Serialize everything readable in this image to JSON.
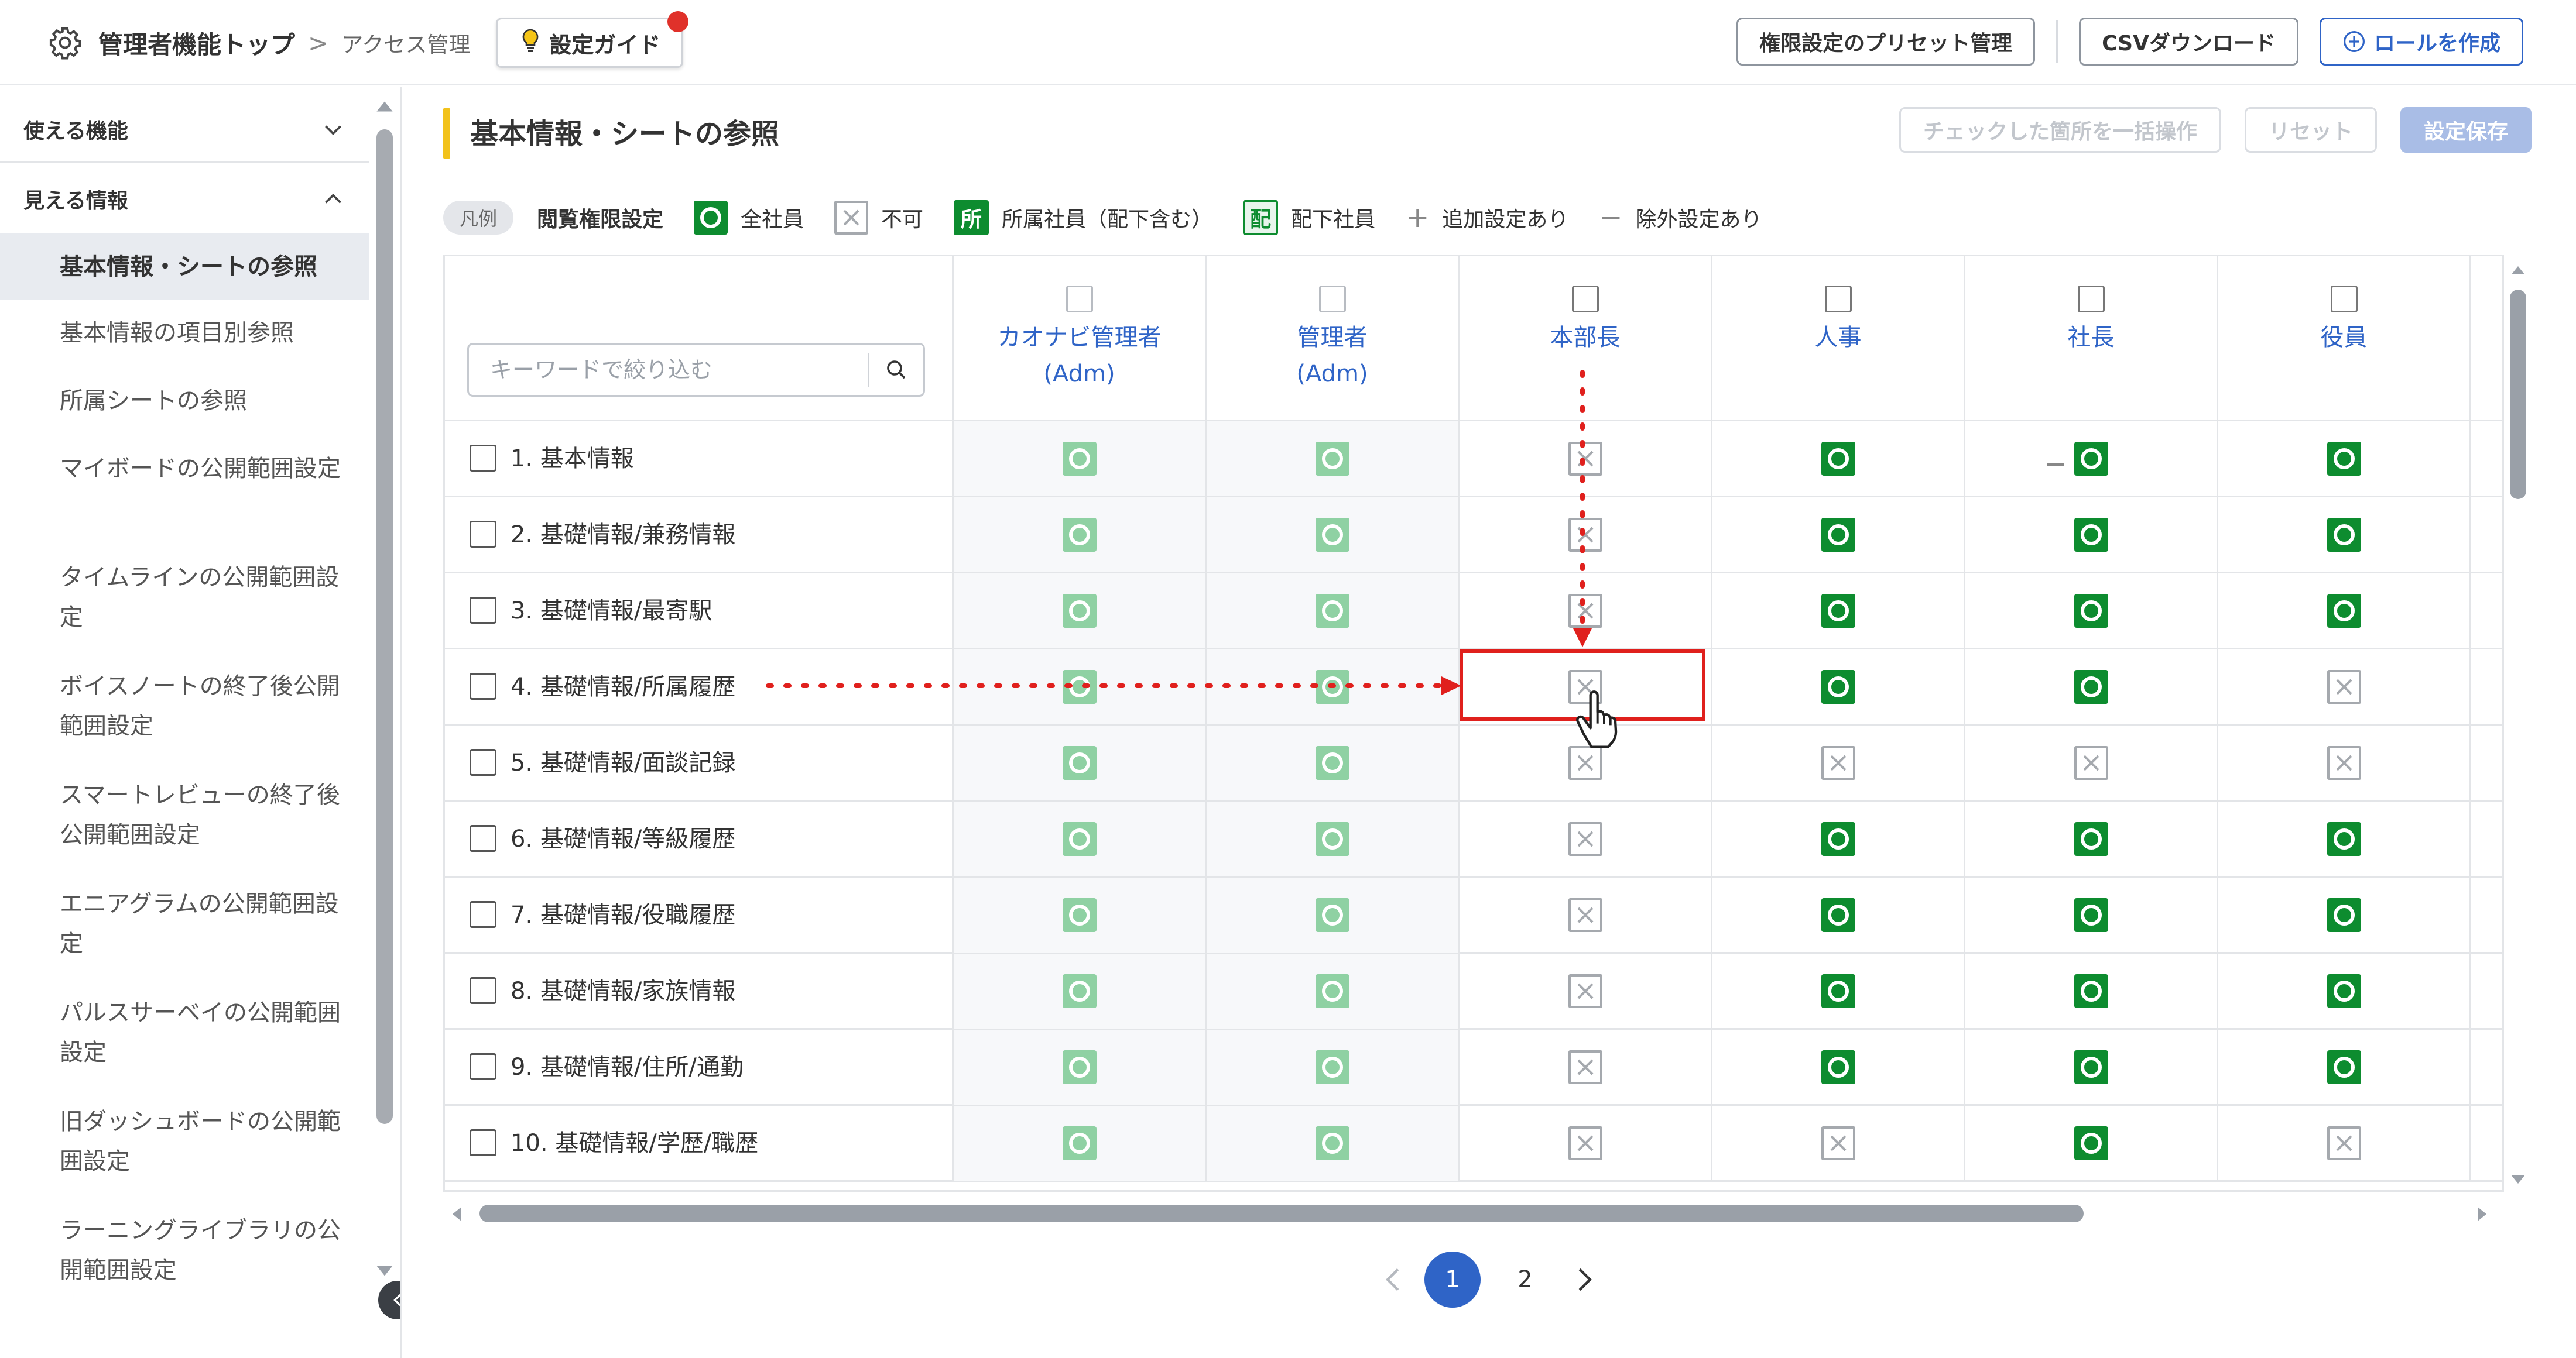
{
  "header": {
    "admin_top": "管理者機能トップ",
    "separator": ">",
    "access_mgmt": "アクセス管理",
    "guide_label": "設定ガイド",
    "preset_btn": "権限設定のプリセット管理",
    "csv_btn": "CSVダウンロード",
    "create_role_btn": "ロールを作成"
  },
  "sidebar": {
    "section_features": "使える機能",
    "section_info": "見える情報",
    "items": [
      {
        "label": "基本情報・シートの参照",
        "active": true
      },
      {
        "label": "基本情報の項目別参照"
      },
      {
        "label": "所属シートの参照"
      },
      {
        "label": "マイボードの公開範囲設定"
      },
      {
        "label": "タイムラインの公開範囲設定"
      },
      {
        "label": "ボイスノートの終了後公開範囲設定"
      },
      {
        "label": "スマートレビューの終了後公開範囲設定"
      },
      {
        "label": "エニアグラムの公開範囲設定"
      },
      {
        "label": "パルスサーベイの公開範囲設定"
      },
      {
        "label": "旧ダッシュボードの公開範囲設定"
      },
      {
        "label": "ラーニングライブラリの公開範囲設定"
      }
    ]
  },
  "main": {
    "title": "基本情報・シートの参照",
    "bulk_btn": "チェックした箇所を一括操作",
    "reset_btn": "リセット",
    "save_btn": "設定保存"
  },
  "legend": {
    "chip": "凡例",
    "title": "閲覧権限設定",
    "all": "全社員",
    "none": "不可",
    "dept_tag": "所",
    "dept": "所属社員（配下含む）",
    "sub_tag": "配",
    "sub": "配下社員",
    "add": "追加設定あり",
    "exclude": "除外設定あり"
  },
  "table": {
    "search_placeholder": "キーワードで絞り込む",
    "columns": [
      {
        "line1": "カオナビ管理者",
        "line2": "(Adm)",
        "dim": true
      },
      {
        "line1": "管理者",
        "line2": "(Adm)",
        "dim": true
      },
      {
        "line1": "本部長",
        "line2": ""
      },
      {
        "line1": "人事",
        "line2": ""
      },
      {
        "line1": "社長",
        "line2": ""
      },
      {
        "line1": "役員",
        "line2": ""
      }
    ],
    "rows": [
      {
        "label": "1. 基本情報",
        "cells": [
          "ok-light",
          "ok-light",
          "ng",
          "ok",
          "ok",
          "ok"
        ]
      },
      {
        "label": "2. 基礎情報/兼務情報",
        "cells": [
          "ok-light",
          "ok-light",
          "ng",
          "ok",
          "ok",
          "ok"
        ]
      },
      {
        "label": "3. 基礎情報/最寄駅",
        "cells": [
          "ok-light",
          "ok-light",
          "ng",
          "ok",
          "ok",
          "ok"
        ]
      },
      {
        "label": "4. 基礎情報/所属履歴",
        "cells": [
          "ok-light",
          "ok-light",
          "ng",
          "ok",
          "ok",
          "ng"
        ]
      },
      {
        "label": "5. 基礎情報/面談記録",
        "cells": [
          "ok-light",
          "ok-light",
          "ng",
          "ng",
          "ng",
          "ng"
        ]
      },
      {
        "label": "6. 基礎情報/等級履歴",
        "cells": [
          "ok-light",
          "ok-light",
          "ng",
          "ok",
          "ok",
          "ok"
        ]
      },
      {
        "label": "7. 基礎情報/役職履歴",
        "cells": [
          "ok-light",
          "ok-light",
          "ng",
          "ok",
          "ok",
          "ok"
        ]
      },
      {
        "label": "8. 基礎情報/家族情報",
        "cells": [
          "ok-light",
          "ok-light",
          "ng",
          "ok",
          "ok",
          "ok"
        ]
      },
      {
        "label": "9. 基礎情報/住所/通勤",
        "cells": [
          "ok-light",
          "ok-light",
          "ng",
          "ok",
          "ok",
          "ok"
        ]
      },
      {
        "label": "10. 基礎情報/学歴/職歴",
        "cells": [
          "ok-light",
          "ok-light",
          "ng",
          "ng",
          "ok",
          "ng"
        ]
      }
    ]
  },
  "pagination": {
    "pages": [
      "1",
      "2"
    ],
    "current": "1"
  },
  "colors": {
    "accent": "#2f64c7",
    "ok": "#0d8c2f",
    "ok_light": "#8fd1a3",
    "highlight": "#e0201d",
    "title_bar": "#f2c21b"
  }
}
